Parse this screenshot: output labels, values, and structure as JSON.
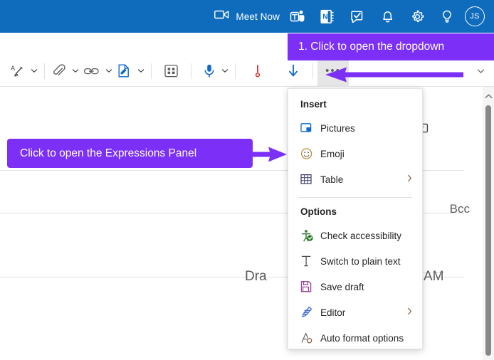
{
  "header": {
    "meet_now_label": "Meet Now",
    "camera_icon": "video-camera-icon",
    "teams_icon": "teams-icon",
    "onenote_icon": "onenote-icon",
    "tasks_icon": "tasks-icon",
    "bell_icon": "notifications-bell-icon",
    "settings_icon": "gear-icon",
    "help_icon": "lightbulb-help-icon",
    "avatar_initials": "JS",
    "background_color": "#0f6cbd"
  },
  "toolbar": {
    "items": [
      {
        "name": "text-format-icon",
        "caret": true
      },
      {
        "name": "attach-file-icon",
        "caret": true
      },
      {
        "name": "insert-link-icon",
        "caret": true
      },
      {
        "name": "signature-icon",
        "caret": true
      },
      {
        "name": "apps-grid-icon",
        "caret": false
      },
      {
        "name": "dictate-microphone-icon",
        "caret": true
      },
      {
        "name": "high-importance-icon",
        "caret": false
      },
      {
        "name": "low-importance-icon",
        "caret": false
      }
    ],
    "more_label": "•••",
    "more_name": "more-options-button",
    "overflow_caret": "chevron-down-icon"
  },
  "menu": {
    "sections": [
      {
        "heading": "Insert",
        "items": [
          {
            "label": "Pictures",
            "icon": "pictures-icon",
            "submenu": false
          },
          {
            "label": "Emoji",
            "icon": "emoji-smiley-icon",
            "submenu": false
          },
          {
            "label": "Table",
            "icon": "table-grid-icon",
            "submenu": true
          }
        ]
      },
      {
        "heading": "Options",
        "items": [
          {
            "label": "Check accessibility",
            "icon": "accessibility-check-icon",
            "submenu": false
          },
          {
            "label": "Switch to plain text",
            "icon": "plain-text-t-icon",
            "submenu": false
          },
          {
            "label": "Save draft",
            "icon": "save-floppy-icon",
            "submenu": false
          },
          {
            "label": "Editor",
            "icon": "editor-pen-icon",
            "submenu": true
          },
          {
            "label": "Auto format options",
            "icon": "auto-format-icon",
            "submenu": false
          }
        ]
      }
    ]
  },
  "callouts": {
    "top": "1. Click to open the dropdown",
    "left": "Click to open the Expressions Panel",
    "color": "#7b2ff7"
  },
  "compose": {
    "bcc_label": "Bcc",
    "draft_prefix": "Dra",
    "draft_suffix": "AM"
  },
  "scrollbar": {
    "up_arrow": "scroll-up-arrow-icon",
    "thumb": "scrollbar-thumb"
  }
}
